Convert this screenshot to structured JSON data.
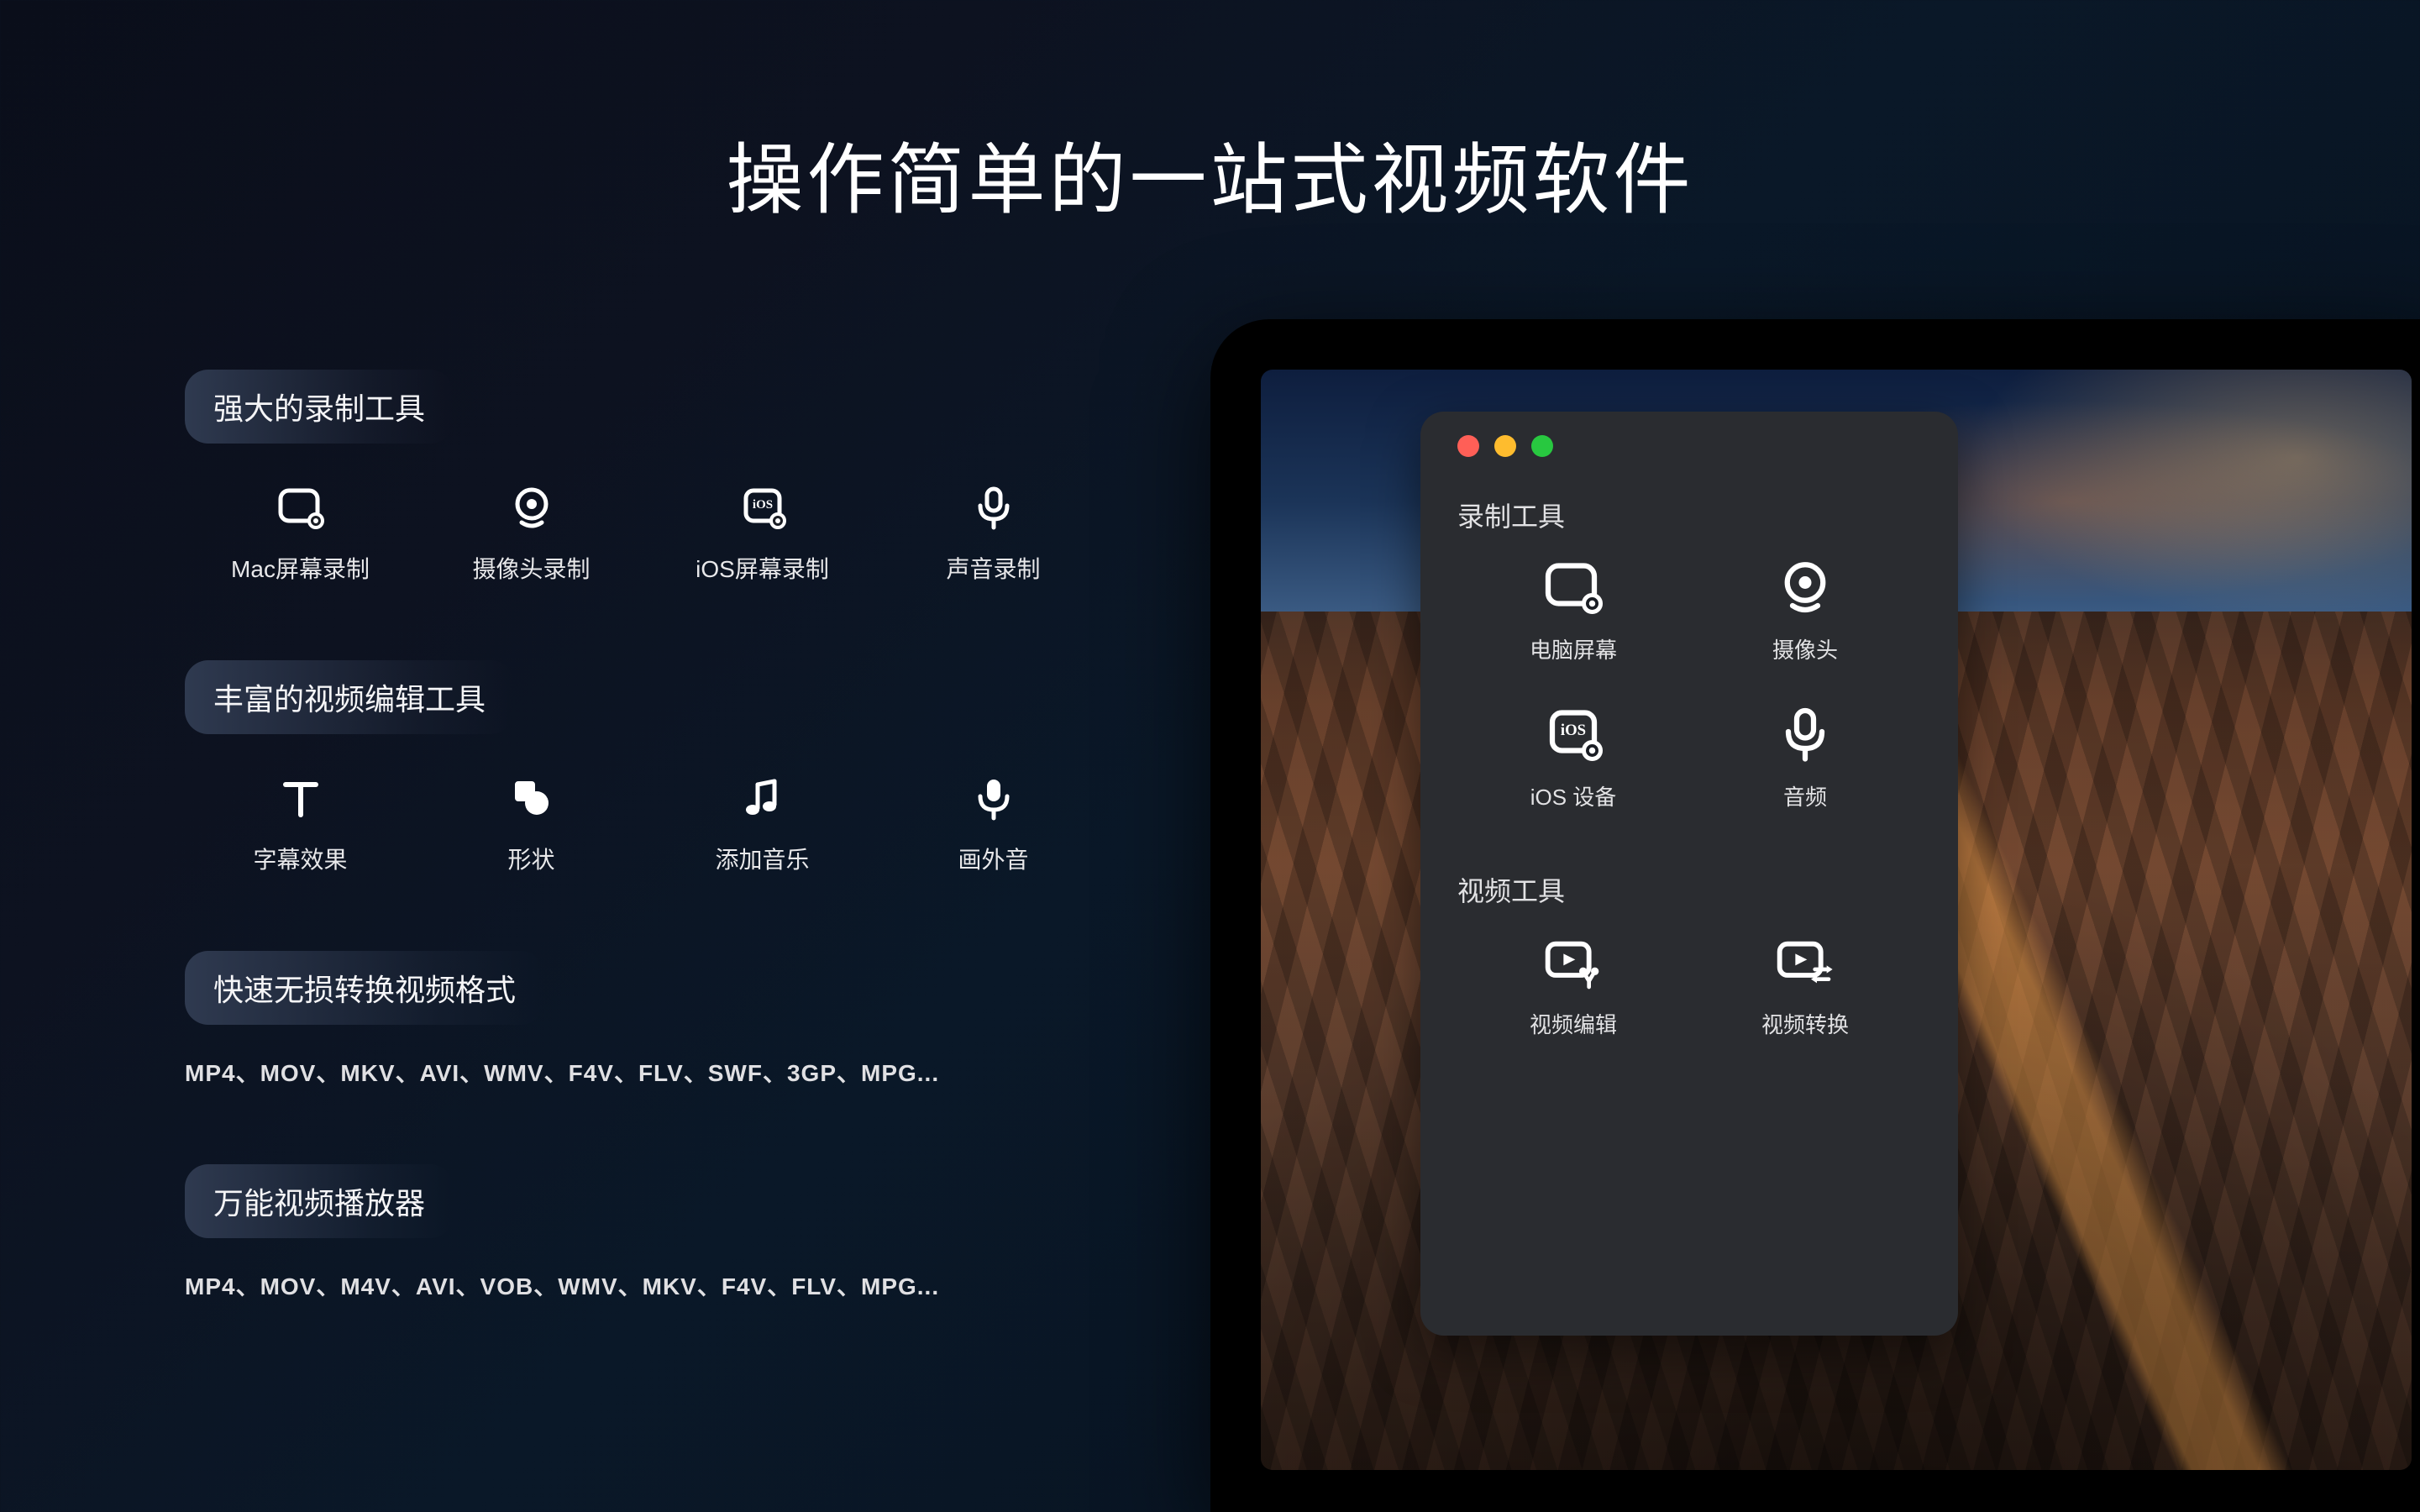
{
  "headline": "操作简单的一站式视频软件",
  "features": {
    "recording": {
      "title": "强大的录制工具",
      "items": [
        {
          "icon": "screen-record-icon",
          "label": "Mac屏幕录制"
        },
        {
          "icon": "camera-icon",
          "label": "摄像头录制"
        },
        {
          "icon": "ios-screen-icon",
          "label": "iOS屏幕录制"
        },
        {
          "icon": "mic-icon",
          "label": "声音录制"
        }
      ]
    },
    "editing": {
      "title": "丰富的视频编辑工具",
      "items": [
        {
          "icon": "text-icon",
          "label": "字幕效果"
        },
        {
          "icon": "shape-icon",
          "label": "形状"
        },
        {
          "icon": "music-icon",
          "label": "添加音乐"
        },
        {
          "icon": "voiceover-icon",
          "label": "画外音"
        }
      ]
    },
    "convert": {
      "title": "快速无损转换视频格式",
      "formats": "MP4、MOV、MKV、AVI、WMV、F4V、FLV、SWF、3GP、MPG..."
    },
    "player": {
      "title": "万能视频播放器",
      "formats": "MP4、MOV、M4V、AVI、VOB、WMV、MKV、F4V、FLV、MPG..."
    }
  },
  "app_window": {
    "record_section": {
      "title": "录制工具",
      "items": [
        {
          "icon": "screen-record-icon",
          "label": "电脑屏幕"
        },
        {
          "icon": "camera-icon",
          "label": "摄像头"
        },
        {
          "icon": "ios-screen-icon",
          "label": "iOS 设备"
        },
        {
          "icon": "mic-icon",
          "label": "音频"
        }
      ]
    },
    "video_section": {
      "title": "视频工具",
      "items": [
        {
          "icon": "video-edit-icon",
          "label": "视频编辑"
        },
        {
          "icon": "video-convert-icon",
          "label": "视频转换"
        }
      ]
    }
  }
}
